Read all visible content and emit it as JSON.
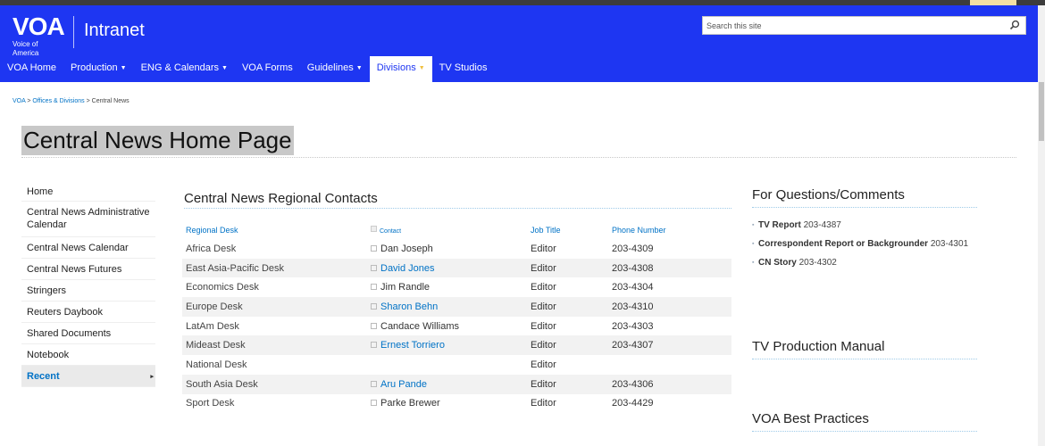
{
  "header": {
    "logo_text": "VOA",
    "logo_tagline": "Voice of America",
    "site_name": "Intranet",
    "search_placeholder": "Search this site"
  },
  "nav": [
    {
      "label": "VOA Home",
      "caret": false,
      "active": false
    },
    {
      "label": "Production",
      "caret": true,
      "active": false
    },
    {
      "label": "ENG & Calendars",
      "caret": true,
      "active": false
    },
    {
      "label": "VOA Forms",
      "caret": false,
      "active": false
    },
    {
      "label": "Guidelines",
      "caret": true,
      "active": false
    },
    {
      "label": "Divisions",
      "caret": true,
      "active": true
    },
    {
      "label": "TV Studios",
      "caret": false,
      "active": false
    }
  ],
  "breadcrumb": {
    "items": [
      "VOA",
      "Offices & Divisions"
    ],
    "separator": ">",
    "current": "Central News"
  },
  "page_title": "Central News Home Page",
  "leftnav": [
    "Home",
    "Central News Administrative Calendar",
    "Central News Calendar",
    "Central News Futures",
    "Stringers",
    "Reuters Daybook",
    "Shared Documents",
    "Notebook",
    "Recent"
  ],
  "contacts": {
    "title": "Central News Regional Contacts",
    "columns": [
      "Regional Desk",
      "Contact",
      "Job Title",
      "Phone Number"
    ],
    "rows": [
      {
        "desk": "Africa Desk",
        "contact": "Dan Joseph",
        "link": false,
        "title": "Editor",
        "phone": "203-4309"
      },
      {
        "desk": "East Asia-Pacific Desk",
        "contact": "David Jones",
        "link": true,
        "title": "Editor",
        "phone": "203-4308"
      },
      {
        "desk": "Economics Desk",
        "contact": "Jim Randle",
        "link": false,
        "title": "Editor",
        "phone": "203-4304"
      },
      {
        "desk": "Europe Desk",
        "contact": "Sharon Behn",
        "link": true,
        "title": "Editor",
        "phone": "203-4310"
      },
      {
        "desk": "LatAm Desk",
        "contact": "Candace Williams",
        "link": false,
        "title": "Editor",
        "phone": "203-4303"
      },
      {
        "desk": "Mideast Desk",
        "contact": "Ernest Torriero",
        "link": true,
        "title": "Editor",
        "phone": "203-4307"
      },
      {
        "desk": "National Desk",
        "contact": "",
        "link": false,
        "title": "Editor",
        "phone": ""
      },
      {
        "desk": "South Asia Desk",
        "contact": "Aru Pande",
        "link": true,
        "title": "Editor",
        "phone": "203-4306"
      },
      {
        "desk": "Sport Desk",
        "contact": "Parke Brewer",
        "link": false,
        "title": "Editor",
        "phone": "203-4429"
      }
    ]
  },
  "questions": {
    "title": "For Questions/Comments",
    "items": [
      {
        "label": "TV Report",
        "value": "203-4387"
      },
      {
        "label": "Correspondent Report or Backgrounder",
        "value": "203-4301"
      },
      {
        "label": "CN Story",
        "value": "203-4302"
      }
    ]
  },
  "tv_manual": {
    "title": "TV Production Manual"
  },
  "best_practices": {
    "title": "VOA Best Practices"
  },
  "colors": {
    "brand_blue": "#1e36f2",
    "link_blue": "#0072c6"
  }
}
